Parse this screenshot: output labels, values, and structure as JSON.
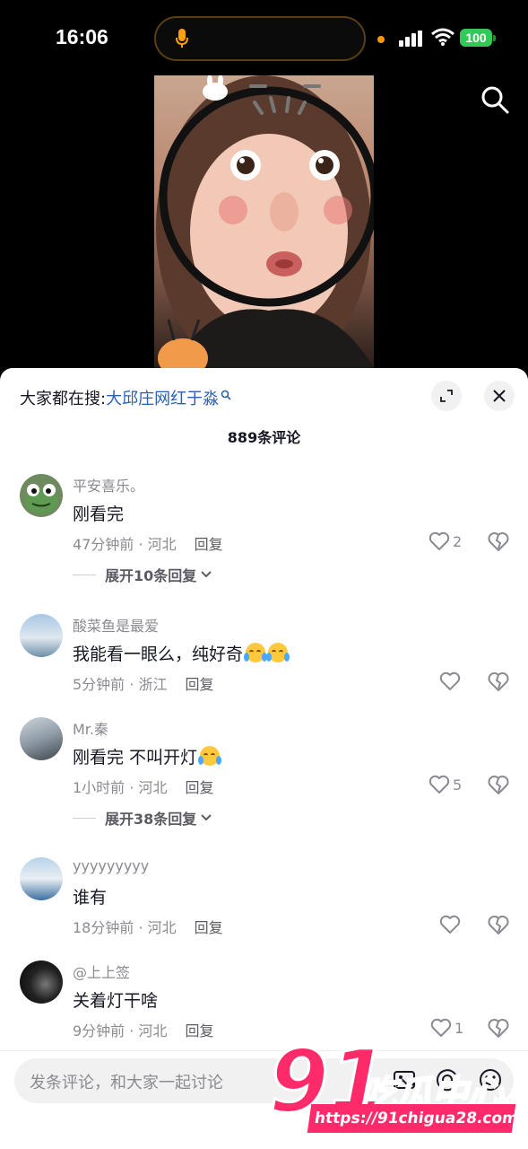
{
  "status_bar": {
    "time": "16:06",
    "battery": "100"
  },
  "sheet": {
    "hot_prefix": "大家都在搜:",
    "hot_keyword": "大邱庄网红于淼",
    "comment_count": "889条评论"
  },
  "comments": [
    {
      "user": "平安喜乐。",
      "text": "刚看完",
      "time_loc": "47分钟前 · 河北",
      "reply": "回复",
      "likes": "2",
      "expand": "展开10条回复"
    },
    {
      "user": "酸菜鱼是最爱",
      "text": "我能看一眼么，纯好奇",
      "time_loc": "5分钟前 · 浙江",
      "reply": "回复",
      "likes": "",
      "expand": ""
    },
    {
      "user": "Mr.秦",
      "text": "刚看完 不叫开灯",
      "time_loc": "1小时前 · 河北",
      "reply": "回复",
      "likes": "5",
      "expand": "展开38条回复"
    },
    {
      "user": "yyyyyyyyy",
      "text": "谁有",
      "time_loc": "18分钟前 · 河北",
      "reply": "回复",
      "likes": "",
      "expand": ""
    },
    {
      "user": "@上上签",
      "text": "关着灯干啥",
      "time_loc": "9分钟前 · 河北",
      "reply": "回复",
      "likes": "1",
      "expand": ""
    }
  ],
  "input": {
    "placeholder": "发条评论，和大家一起讨论"
  },
  "watermark": {
    "brand": "吃瓜中心",
    "number": "91",
    "url": "https://91chigua28.com"
  },
  "colors": {
    "keyword": "#2a5fb2",
    "battery": "#34c759",
    "watermark": "#ff2a6a"
  }
}
